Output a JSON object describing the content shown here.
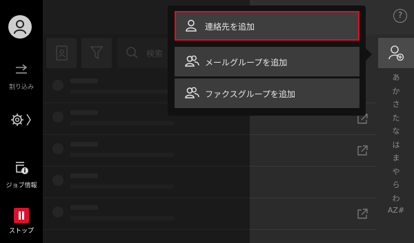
{
  "leftbar": {
    "items": [
      {
        "label": "割り込み",
        "icon": "interrupt-icon"
      },
      {
        "label": "",
        "icon": "gear-icon"
      },
      {
        "label": "ジョブ情報",
        "icon": "job-info-icon"
      },
      {
        "label": "ストップ",
        "icon": "stop-icon"
      }
    ]
  },
  "toolbar": {
    "search_placeholder": "検索"
  },
  "menu": {
    "items": [
      {
        "label": "連絡先を追加",
        "icon": "person-icon",
        "selected": true
      },
      {
        "label": "メールグループを追加",
        "icon": "group-icon"
      },
      {
        "label": "ファクスグループを追加",
        "icon": "group-icon"
      }
    ],
    "highlight_color": "#e30b24"
  },
  "index": [
    "あ",
    "か",
    "さ",
    "た",
    "な",
    "は",
    "ま",
    "や",
    "ら",
    "わ",
    "AZ#"
  ],
  "help_symbol": "?",
  "colors": {
    "stop": "#e0102a",
    "background": "#2b2b2b"
  }
}
